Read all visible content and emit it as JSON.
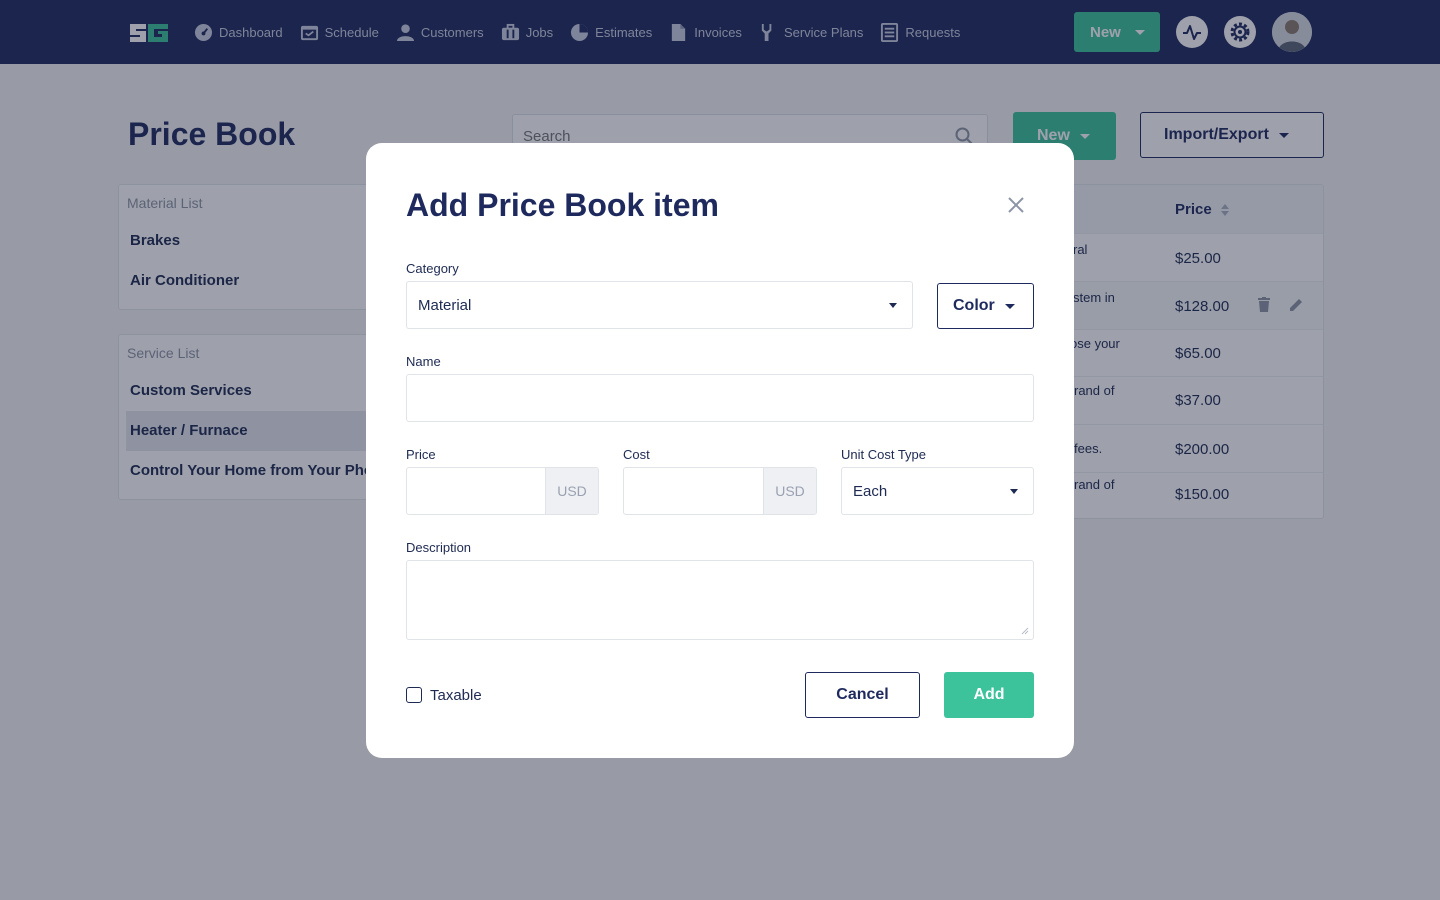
{
  "nav": {
    "items": [
      {
        "label": "Dashboard",
        "icon": "gauge-icon"
      },
      {
        "label": "Schedule",
        "icon": "calendar-icon"
      },
      {
        "label": "Customers",
        "icon": "user-icon"
      },
      {
        "label": "Jobs",
        "icon": "briefcase-icon"
      },
      {
        "label": "Estimates",
        "icon": "estimate-icon"
      },
      {
        "label": "Invoices",
        "icon": "document-icon"
      },
      {
        "label": "Service Plans",
        "icon": "wrench-icon"
      },
      {
        "label": "Requests",
        "icon": "list-icon"
      }
    ],
    "new_label": "New"
  },
  "page": {
    "title": "Price Book",
    "search_placeholder": "Search",
    "new_label": "New",
    "import_export_label": "Import/Export"
  },
  "material_list": {
    "heading": "Material List",
    "items": [
      "Brakes",
      "Air Conditioner"
    ]
  },
  "service_list": {
    "heading": "Service List",
    "items": [
      "Custom Services",
      "Heater / Furnace",
      "Control Your Home from Your Phone"
    ],
    "active_index": 1
  },
  "table": {
    "price_header": "Price",
    "rows": [
      {
        "desc": "ral",
        "price": "$25.00"
      },
      {
        "desc": "stem in",
        "price": "$128.00"
      },
      {
        "desc": "ose your",
        "price": "$65.00"
      },
      {
        "desc": "rand of",
        "price": "$37.00"
      },
      {
        "desc": "fees.",
        "price": "$200.00"
      },
      {
        "desc": "rand of",
        "price": "$150.00"
      }
    ]
  },
  "modal": {
    "title": "Add Price Book item",
    "category_label": "Category",
    "category_value": "Material",
    "color_label": "Color",
    "name_label": "Name",
    "name_value": "",
    "price_label": "Price",
    "price_value": "",
    "price_currency": "USD",
    "cost_label": "Cost",
    "cost_value": "",
    "cost_currency": "USD",
    "unit_cost_type_label": "Unit Cost Type",
    "unit_cost_type_value": "Each",
    "description_label": "Description",
    "description_value": "",
    "taxable_label": "Taxable",
    "taxable_checked": false,
    "cancel_label": "Cancel",
    "add_label": "Add"
  },
  "colors": {
    "navy": "#1e2a5e",
    "accent_green": "#3cc39c"
  }
}
